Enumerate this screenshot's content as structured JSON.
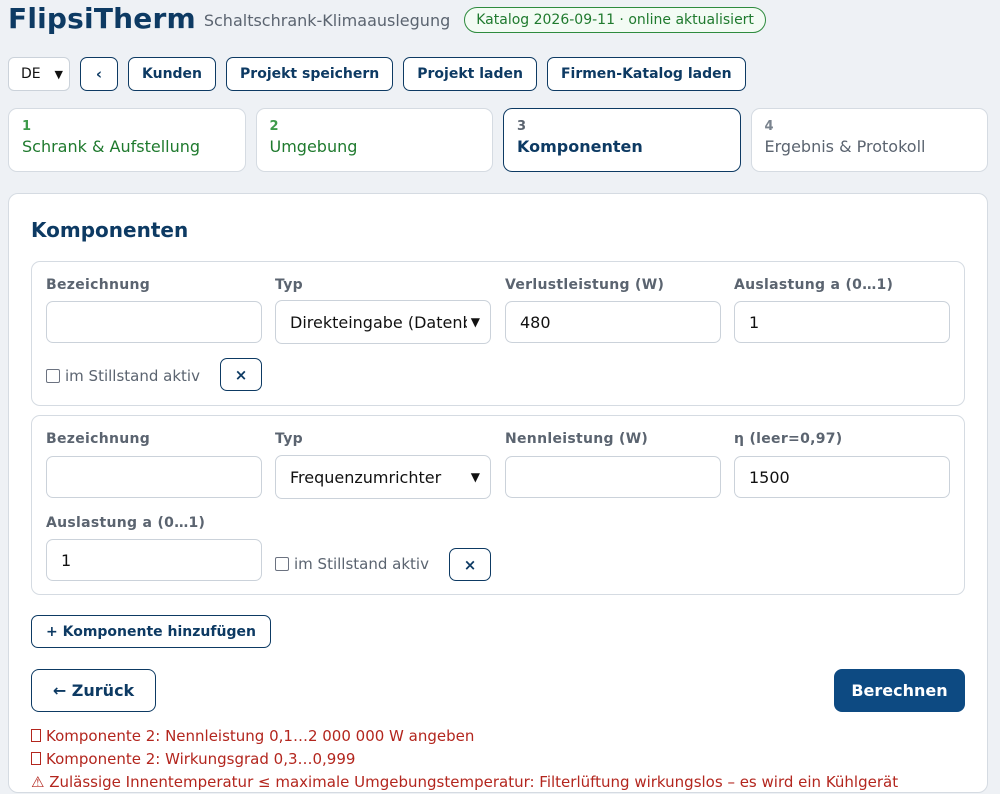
{
  "header": {
    "app_name": "FlipsiTherm",
    "subtitle": "Schaltschrank-Klimaauslegung",
    "catalog_badge": "Katalog 2026-09-11 · online aktualisiert"
  },
  "toolbar": {
    "language": "DE",
    "back_icon": "‹",
    "customers": "Kunden",
    "save_project": "Projekt speichern",
    "load_project": "Projekt laden",
    "load_catalog": "Firmen-Katalog laden"
  },
  "steps": [
    {
      "num": "1",
      "label": "Schrank & Aufstellung",
      "state": "done"
    },
    {
      "num": "2",
      "label": "Umgebung",
      "state": "done"
    },
    {
      "num": "3",
      "label": "Komponenten",
      "state": "active"
    },
    {
      "num": "4",
      "label": "Ergebnis & Protokoll",
      "state": "future"
    }
  ],
  "main": {
    "title": "Komponenten",
    "components": [
      {
        "label_name": "Bezeichnung",
        "name_value": "",
        "label_type": "Typ",
        "type_value": "Direkteingabe (Datenblatt)",
        "label_power": "Verlustleistung (W)",
        "power_value": "480",
        "label_load": "Auslastung a (0…1)",
        "load_value": "1",
        "standby_label": "im Stillstand aktiv",
        "standby_checked": false,
        "remove_icon": "×"
      },
      {
        "label_name": "Bezeichnung",
        "name_value": "",
        "label_type": "Typ",
        "type_value": "Frequenzumrichter",
        "label_rated": "Nennleistung (W)",
        "rated_value": "",
        "label_eta": "η (leer=0,97)",
        "eta_value": "1500",
        "label_load": "Auslastung a (0…1)",
        "load_value": "1",
        "standby_label": "im Stillstand aktiv",
        "standby_checked": false,
        "remove_icon": "×"
      }
    ],
    "add_button": "+ Komponente hinzufügen",
    "back_button": "← Zurück",
    "calc_button": "Berechnen",
    "errors": [
      {
        "icon": "error-icon",
        "text": "Komponente 2: Nennleistung 0,1…2 000 000 W angeben"
      },
      {
        "icon": "error-icon",
        "text": "Komponente 2: Wirkungsgrad 0,3…0,999"
      },
      {
        "icon": "warning-icon",
        "text": "⚠ Zulässige Innentemperatur ≤ maximale Umgebungstemperatur: Filterlüftung wirkungslos – es wird ein Kühlgerät"
      }
    ]
  },
  "colors": {
    "brand": "#0d3a63",
    "primary_button": "#0d4a82",
    "done_step": "#1f7a2e",
    "error": "#b3261e",
    "badge_border": "#2e8b3e"
  }
}
